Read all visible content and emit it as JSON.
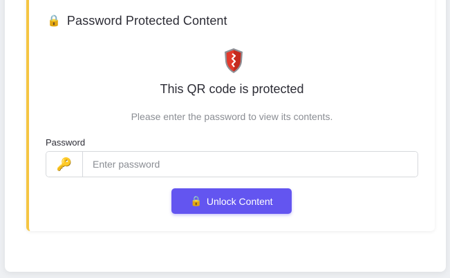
{
  "panel": {
    "title": "Password Protected Content",
    "title_icon": "lock-icon",
    "accent_color": "#f5c542"
  },
  "protected": {
    "icon": "shield-icon",
    "headline": "This QR code is protected",
    "description": "Please enter the password to view its contents."
  },
  "form": {
    "label": "Password",
    "addon_icon": "key-icon",
    "placeholder": "Enter password",
    "value": ""
  },
  "button": {
    "label": "Unlock Content",
    "icon": "lock-icon",
    "color": "#6355f0"
  }
}
